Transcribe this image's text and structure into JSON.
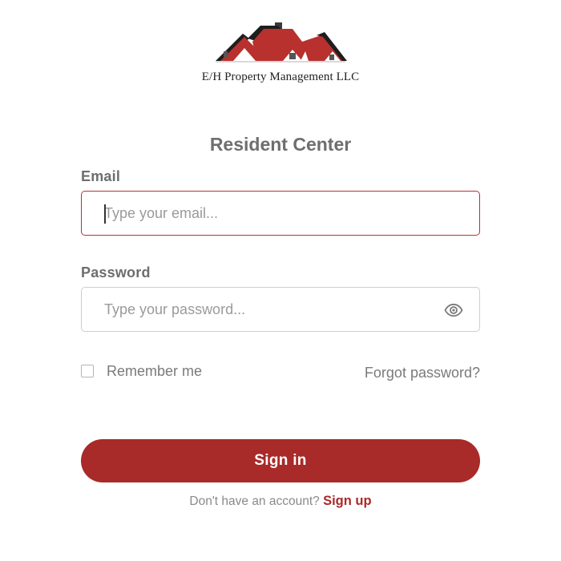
{
  "brand": {
    "company_name": "E/H Property Management LLC",
    "logo_icon": "houses-logo",
    "accent_color": "#a82a29"
  },
  "form": {
    "title": "Resident Center",
    "email": {
      "label": "Email",
      "placeholder": "Type your email...",
      "value": ""
    },
    "password": {
      "label": "Password",
      "placeholder": "Type your password...",
      "value": "",
      "reveal_icon": "eye-icon"
    },
    "remember": {
      "label": "Remember me",
      "checked": false
    },
    "forgot_label": "Forgot password?",
    "signin_label": "Sign in",
    "signup_prompt": "Don't have an account?",
    "signup_label": "Sign up"
  }
}
